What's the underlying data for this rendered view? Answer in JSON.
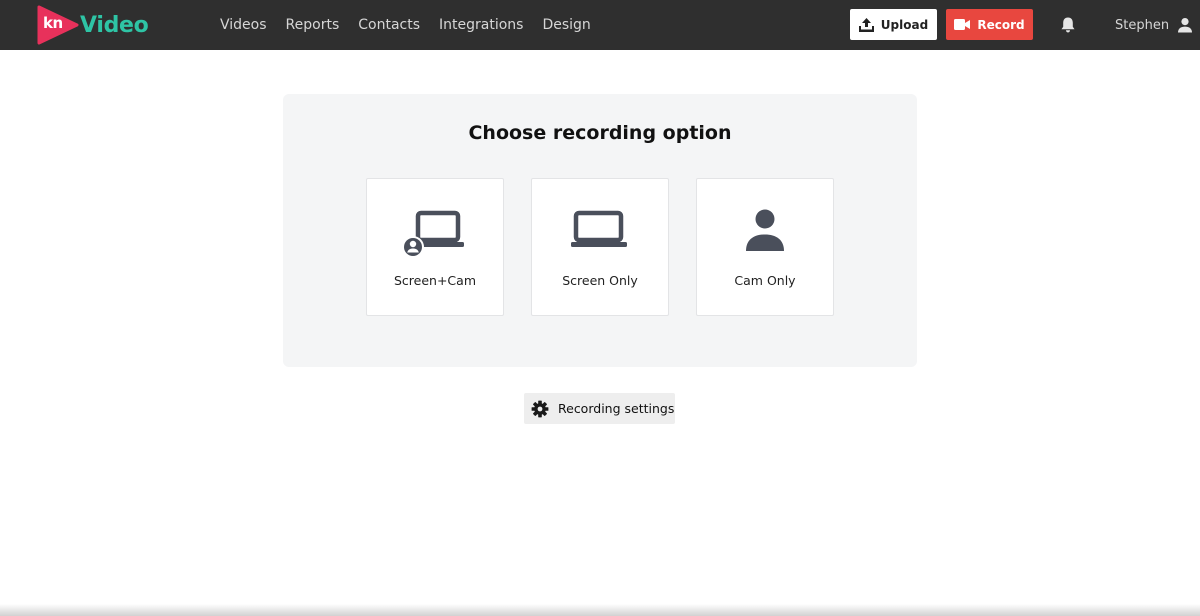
{
  "brand": {
    "logo_mark_text": "kn",
    "logo_word": "Video",
    "logo_color": "#e8315b",
    "word_color": "#2ec4a5"
  },
  "nav": {
    "items": [
      "Videos",
      "Reports",
      "Contacts",
      "Integrations",
      "Design"
    ]
  },
  "header": {
    "upload_label": "Upload",
    "record_label": "Record",
    "record_color": "#e8473f",
    "user_name": "Stephen"
  },
  "main": {
    "title": "Choose recording option",
    "options": [
      {
        "label": "Screen+Cam",
        "icon": "laptop-with-user-icon"
      },
      {
        "label": "Screen Only",
        "icon": "laptop-icon"
      },
      {
        "label": "Cam Only",
        "icon": "user-icon"
      }
    ],
    "settings_label": "Recording settings"
  }
}
